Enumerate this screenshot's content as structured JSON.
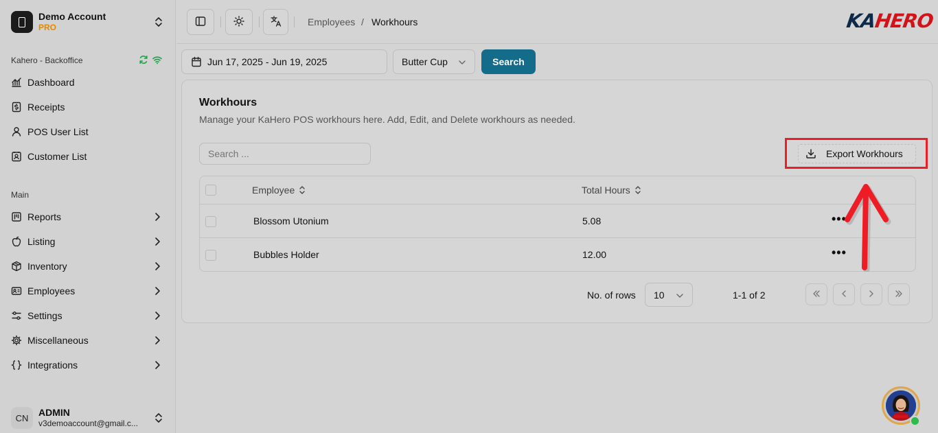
{
  "account": {
    "name": "Demo Account",
    "tier": "PRO"
  },
  "sidebar": {
    "store_label": "Kahero - Backoffice",
    "top_items": [
      {
        "label": "Dashboard",
        "icon": "chart-icon"
      },
      {
        "label": "Receipts",
        "icon": "receipt-icon"
      },
      {
        "label": "POS User List",
        "icon": "user-icon"
      },
      {
        "label": "Customer List",
        "icon": "contact-icon"
      }
    ],
    "main_label": "Main",
    "main_items": [
      {
        "label": "Reports",
        "icon": "report-icon"
      },
      {
        "label": "Listing",
        "icon": "apple-icon"
      },
      {
        "label": "Inventory",
        "icon": "box-icon"
      },
      {
        "label": "Employees",
        "icon": "id-card-icon"
      },
      {
        "label": "Settings",
        "icon": "sliders-icon"
      },
      {
        "label": "Miscellaneous",
        "icon": "gear-icon"
      },
      {
        "label": "Integrations",
        "icon": "braces-icon"
      }
    ]
  },
  "user": {
    "initials": "CN",
    "name": "ADMIN",
    "email": "v3demoaccount@gmail.c..."
  },
  "breadcrumb": {
    "parent": "Employees",
    "separator": "/",
    "current": "Workhours"
  },
  "brand": {
    "part1": "KA",
    "part2": "HERO"
  },
  "filters": {
    "date_range": "Jun 17, 2025 - Jun 19, 2025",
    "store": "Butter Cup",
    "search_label": "Search"
  },
  "card": {
    "title": "Workhours",
    "description": "Manage your KaHero POS workhours here. Add, Edit, and Delete workhours as needed.",
    "search_placeholder": "Search ...",
    "export_label": "Export Workhours"
  },
  "table": {
    "columns": [
      "Employee",
      "Total Hours"
    ],
    "rows": [
      {
        "employee": "Blossom Utonium",
        "hours": "5.08",
        "actions": "•••"
      },
      {
        "employee": "Bubbles Holder",
        "hours": "12.00",
        "actions": "•••"
      }
    ]
  },
  "pagination": {
    "rows_label": "No. of rows",
    "rows_value": "10",
    "info": "1-1 of 2"
  },
  "colors": {
    "accent": "#126c8a",
    "highlight": "#ee1c25",
    "pro": "#e08a00",
    "online": "#2dbb4e"
  }
}
